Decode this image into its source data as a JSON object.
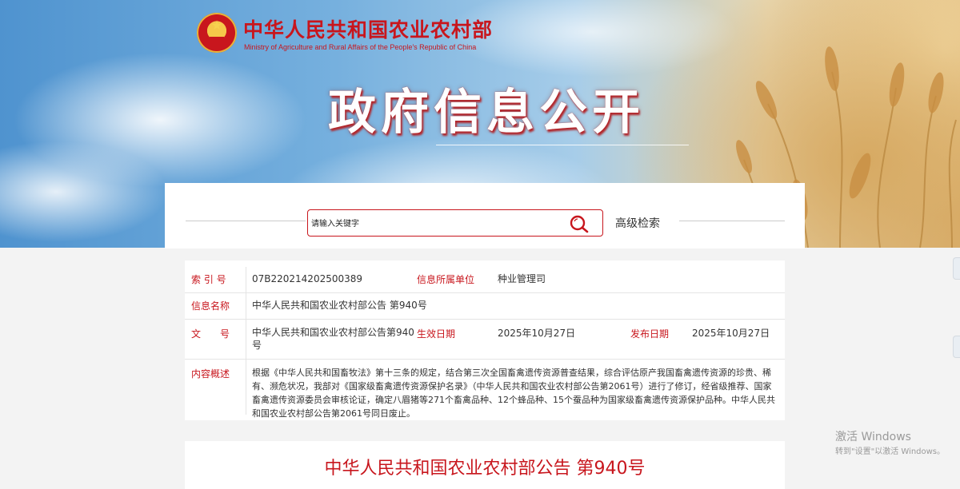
{
  "header": {
    "ministry_cn": "中华人民共和国农业农村部",
    "ministry_en": "Ministry of Agriculture and Rural Affairs of the People's Republic of China",
    "banner_title": "政府信息公开"
  },
  "search": {
    "placeholder": "请输入关键字",
    "advanced_label": "高级检索"
  },
  "info": {
    "index_label": "索 引 号",
    "index_value": "07B220214202500389",
    "unit_label": "信息所属单位",
    "unit_value": "种业管理司",
    "name_label": "信息名称",
    "name_value": "中华人民共和国农业农村部公告 第940号",
    "docno_label": "文　　号",
    "docno_value": "中华人民共和国农业农村部公告第940号",
    "effective_label": "生效日期",
    "effective_value": "2025年10月27日",
    "publish_label": "发布日期",
    "publish_value": "2025年10月27日",
    "summary_label": "内容概述",
    "summary_value": "根据《中华人民共和国畜牧法》第十三条的规定，结合第三次全国畜禽遗传资源普查结果，综合评估原产我国畜禽遗传资源的珍贵、稀有、濒危状况，我部对《国家级畜禽遗传资源保护名录》（中华人民共和国农业农村部公告第2061号）进行了修订，经省级推荐、国家畜禽遗传资源委员会审核论证，确定八眉猪等271个畜禽品种、12个蜂品种、15个蚕品种为国家级畜禽遗传资源保护品种。中华人民共和国农业农村部公告第2061号同日废止。"
  },
  "document": {
    "title": "中华人民共和国农业农村部公告 第940号"
  },
  "watermark": {
    "line1": "激活 Windows",
    "line2": "转到\"设置\"以激活 Windows。"
  },
  "icons": {
    "search": "search-icon",
    "emblem": "national-emblem-icon"
  },
  "colors": {
    "brand_red": "#c8161d",
    "label_red": "#c8161d"
  }
}
